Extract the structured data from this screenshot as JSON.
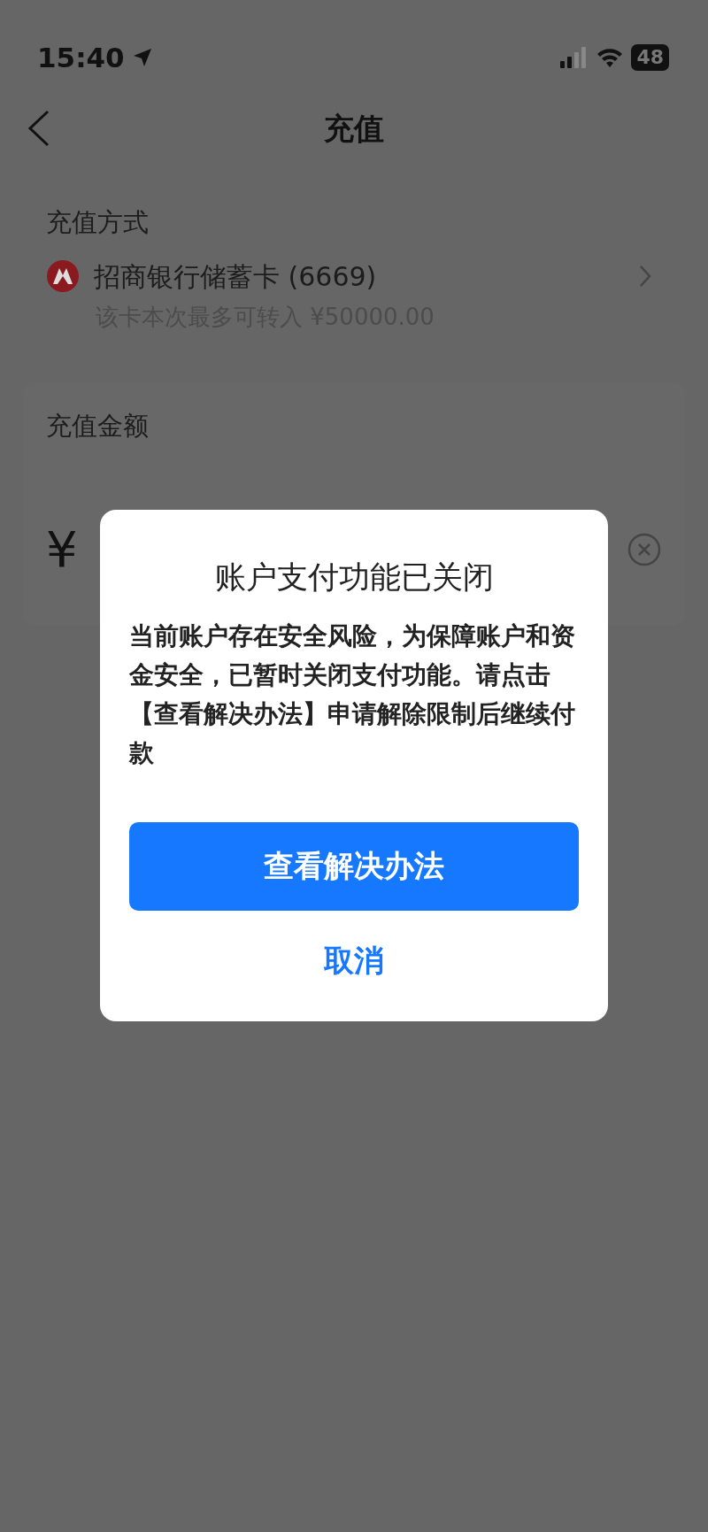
{
  "status_bar": {
    "time": "15:40",
    "battery": "48"
  },
  "nav": {
    "title": "充值"
  },
  "payment_method": {
    "label": "充值方式",
    "bank_name": "招商银行储蓄卡 (6669)",
    "limit_text": "该卡本次最多可转入 ¥50000.00"
  },
  "amount": {
    "label": "充值金额",
    "currency": "¥"
  },
  "dialog": {
    "title": "账户支付功能已关闭",
    "message": "当前账户存在安全风险，为保障账户和资金安全，已暂时关闭支付功能。请点击【查看解决办法】申请解除限制后继续付款",
    "primary_button": "查看解决办法",
    "cancel_button": "取消"
  }
}
